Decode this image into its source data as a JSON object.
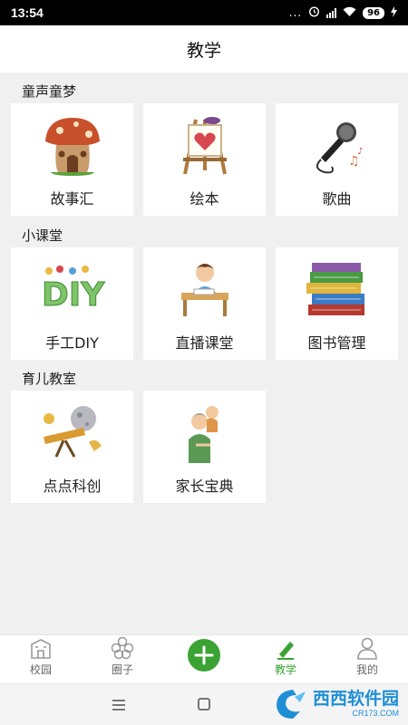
{
  "status_bar": {
    "time": "13:54",
    "dots": "...",
    "battery": "96"
  },
  "header": {
    "title": "教学"
  },
  "sections": [
    {
      "title": "童声童梦",
      "items": [
        {
          "label": "故事汇",
          "icon": "mushroom-house-icon"
        },
        {
          "label": "绘本",
          "icon": "easel-heart-icon"
        },
        {
          "label": "歌曲",
          "icon": "microphone-icon"
        }
      ]
    },
    {
      "title": "小课堂",
      "items": [
        {
          "label": "手工DIY",
          "icon": "diy-letters-icon"
        },
        {
          "label": "直播课堂",
          "icon": "student-desk-icon"
        },
        {
          "label": "图书管理",
          "icon": "book-stack-icon"
        }
      ]
    },
    {
      "title": "育儿教室",
      "items": [
        {
          "label": "点点科创",
          "icon": "telescope-icon"
        },
        {
          "label": "家长宝典",
          "icon": "parent-child-icon"
        }
      ]
    }
  ],
  "tab_bar": {
    "items": [
      {
        "label": "校园",
        "icon": "school-building-icon",
        "active": false
      },
      {
        "label": "圈子",
        "icon": "flower-circle-icon",
        "active": false
      },
      {
        "label": "",
        "icon": "plus-icon",
        "active": false
      },
      {
        "label": "教学",
        "icon": "pencil-icon",
        "active": true
      },
      {
        "label": "我的",
        "icon": "person-icon",
        "active": false
      }
    ]
  },
  "watermark": {
    "main": "西西软件园",
    "sub": "CR173.COM"
  },
  "colors": {
    "accent": "#3aa334",
    "background": "#f0f0f0",
    "statusbar": "#000000"
  }
}
